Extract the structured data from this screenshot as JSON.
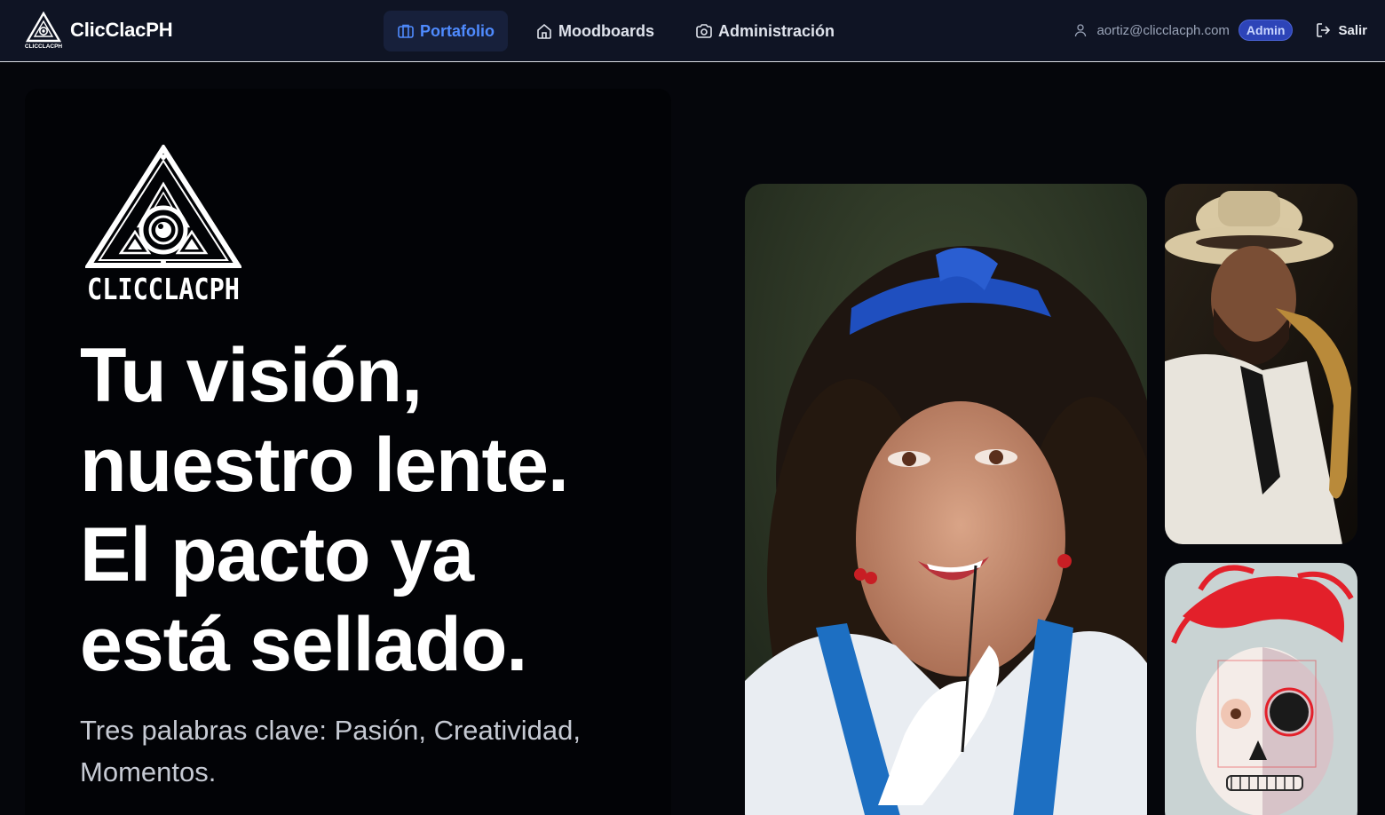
{
  "brand": {
    "name": "ClicClacPH",
    "logo_text": "CLICCLACPH",
    "logo_icon": "eye-triangle-logo-icon"
  },
  "nav": {
    "items": [
      {
        "label": "Portafolio",
        "icon": "portfolio-icon",
        "active": true
      },
      {
        "label": "Moodboards",
        "icon": "home-icon",
        "active": false
      },
      {
        "label": "Administración",
        "icon": "camera-icon",
        "active": false
      }
    ]
  },
  "user": {
    "email": "aortiz@clicclacph.com",
    "role": "Admin",
    "logout_label": "Salir",
    "icon": "user-icon",
    "logout_icon": "logout-icon"
  },
  "hero": {
    "title_lines": [
      "Tu visión,",
      "nuestro lente.",
      "El pacto ya",
      "está sellado."
    ],
    "subtitle": "Tres palabras clave: Pasión, Creatividad, Momentos."
  },
  "gallery": {
    "photos": [
      {
        "name": "portrait-woman-blue-headband"
      },
      {
        "name": "saxophonist-straw-hat"
      },
      {
        "name": "catrina-makeup-red-fascinator"
      }
    ]
  },
  "colors": {
    "nav_bg": "#0f1424",
    "page_bg": "#05060b",
    "accent": "#4f8bff",
    "badge": "#2d44b8"
  }
}
